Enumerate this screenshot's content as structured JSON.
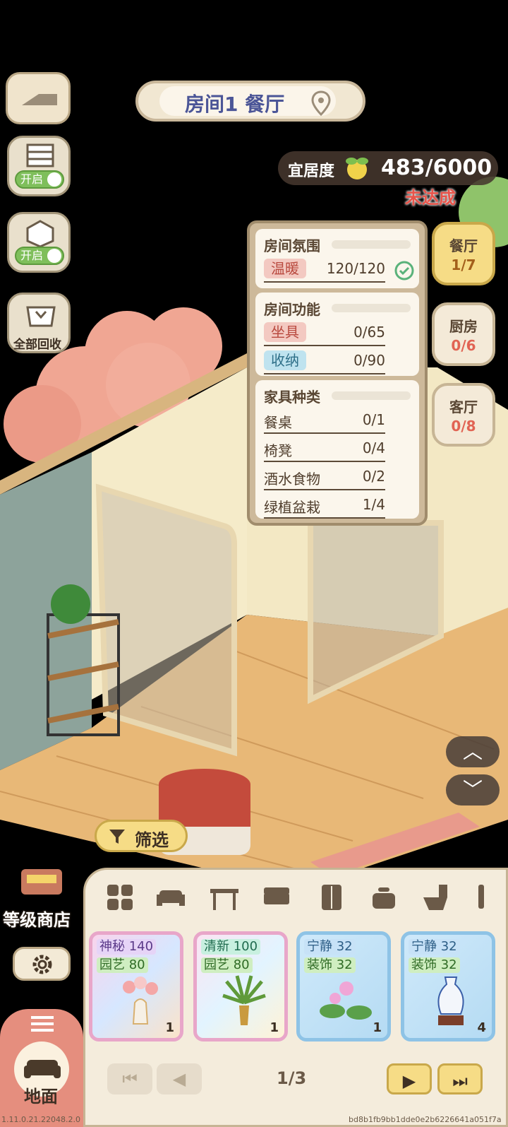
{
  "room": {
    "title": "房间1 餐厅"
  },
  "comfort": {
    "label": "宜居度",
    "score": "483/6000",
    "status": "未达成"
  },
  "side_buttons": {
    "toggle1_label": "开启",
    "toggle2_label": "开启",
    "recycle_label": "全部回收"
  },
  "panel": {
    "atmosphere": {
      "title": "房间氛围",
      "tag": "温暖",
      "value": "120/120"
    },
    "function": {
      "title": "房间功能",
      "rows": [
        {
          "tag": "坐具",
          "value": "0/65"
        },
        {
          "tag": "收纳",
          "value": "0/90"
        }
      ]
    },
    "furniture": {
      "title": "家具种类",
      "rows": [
        {
          "label": "餐桌",
          "value": "0/1"
        },
        {
          "label": "椅凳",
          "value": "0/4"
        },
        {
          "label": "酒水食物",
          "value": "0/2"
        },
        {
          "label": "绿植盆栽",
          "value": "1/4"
        }
      ]
    }
  },
  "room_tabs": [
    {
      "name": "餐厅",
      "count": "1/7"
    },
    {
      "name": "厨房",
      "count": "0/6"
    },
    {
      "name": "客厅",
      "count": "0/8"
    }
  ],
  "filter": {
    "label": "筛选"
  },
  "left_bottom": {
    "shop_label": "等级商店",
    "floor_label": "地面"
  },
  "items": [
    {
      "stat1": "神秘",
      "v1": "140",
      "stat2": "园艺",
      "v2": "80",
      "count": "1"
    },
    {
      "stat1": "清新",
      "v1": "100",
      "stat2": "园艺",
      "v2": "80",
      "count": "1"
    },
    {
      "stat1": "宁静",
      "v1": "32",
      "stat2": "装饰",
      "v2": "32",
      "count": "1"
    },
    {
      "stat1": "宁静",
      "v1": "32",
      "stat2": "装饰",
      "v2": "32",
      "count": "4"
    }
  ],
  "pager": {
    "page": "1/3"
  },
  "version": {
    "left": "1.11.0.21.22048.2.0",
    "right": "bd8b1fb9bb1dde0e2b6226641a051f7a"
  },
  "colors": {
    "accent_red": "#e16353",
    "panel_bg": "#fbf6ec",
    "tag_warm": "#f3c9c1",
    "tag_blue": "#bfe3ef"
  }
}
